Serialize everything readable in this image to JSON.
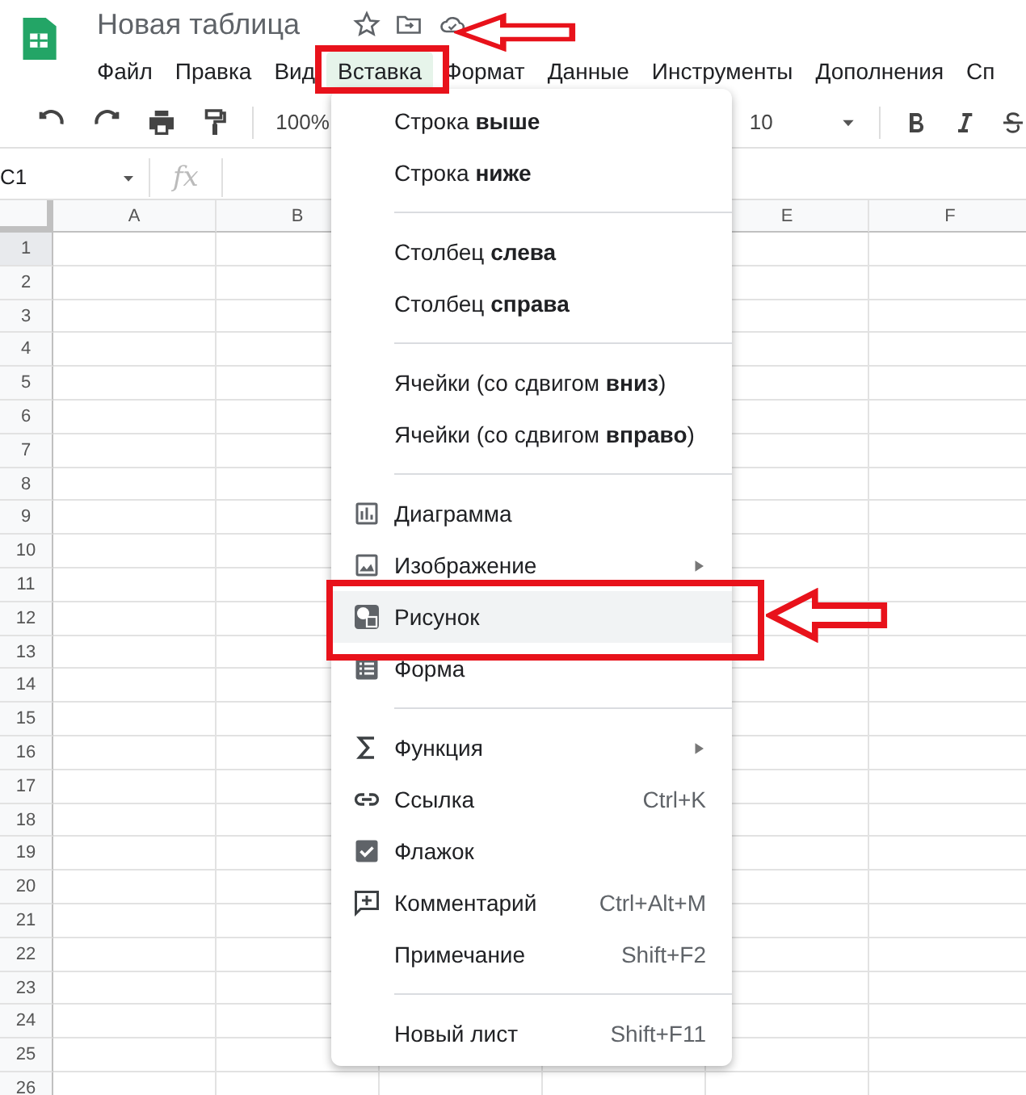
{
  "document": {
    "title": "Новая таблица"
  },
  "menu_bar": [
    {
      "label": "Файл",
      "selected": false
    },
    {
      "label": "Правка",
      "selected": false
    },
    {
      "label": "Вид",
      "selected": false
    },
    {
      "label": "Вставка",
      "selected": true
    },
    {
      "label": "Формат",
      "selected": false
    },
    {
      "label": "Данные",
      "selected": false
    },
    {
      "label": "Инструменты",
      "selected": false
    },
    {
      "label": "Дополнения",
      "selected": false
    },
    {
      "label": "Сп",
      "selected": false
    }
  ],
  "toolbar": {
    "zoom": "100%",
    "font_size": "10"
  },
  "formula_bar": {
    "name_box": "C1",
    "function_label": "fx"
  },
  "columns": [
    "A",
    "B",
    null,
    null,
    "E",
    "F"
  ],
  "rows": [
    {
      "label": "1",
      "selected": true
    },
    {
      "label": "2",
      "selected": false
    },
    {
      "label": "3",
      "selected": false
    },
    {
      "label": "4",
      "selected": false
    },
    {
      "label": "5",
      "selected": false
    },
    {
      "label": "6",
      "selected": false
    },
    {
      "label": "7",
      "selected": false
    },
    {
      "label": "8",
      "selected": false
    },
    {
      "label": "9",
      "selected": false
    },
    {
      "label": "10",
      "selected": false
    },
    {
      "label": "11",
      "selected": false
    },
    {
      "label": "12",
      "selected": false
    },
    {
      "label": "13",
      "selected": false
    },
    {
      "label": "14",
      "selected": false
    },
    {
      "label": "15",
      "selected": false
    },
    {
      "label": "16",
      "selected": false
    },
    {
      "label": "17",
      "selected": false
    },
    {
      "label": "18",
      "selected": false
    },
    {
      "label": "19",
      "selected": false
    },
    {
      "label": "20",
      "selected": false
    },
    {
      "label": "21",
      "selected": false
    },
    {
      "label": "22",
      "selected": false
    },
    {
      "label": "23",
      "selected": false
    },
    {
      "label": "24",
      "selected": false
    },
    {
      "label": "25",
      "selected": false
    },
    {
      "label": "26",
      "selected": false
    }
  ],
  "insert_menu": [
    {
      "kind": "item",
      "label": "Строка **выше**",
      "selected": false
    },
    {
      "kind": "item",
      "label": "Строка **ниже**",
      "selected": false
    },
    {
      "kind": "separator"
    },
    {
      "kind": "item",
      "label": "Столбец **слева**",
      "selected": false
    },
    {
      "kind": "item",
      "label": "Столбец **справа**",
      "selected": false
    },
    {
      "kind": "separator"
    },
    {
      "kind": "item",
      "label": "Ячейки (со сдвигом **вниз**)",
      "selected": false
    },
    {
      "kind": "item",
      "label": "Ячейки (со сдвигом **вправо**)",
      "selected": false
    },
    {
      "kind": "separator"
    },
    {
      "kind": "item",
      "label": "Диаграмма",
      "selected": false
    },
    {
      "kind": "item",
      "label": "Изображение",
      "selected": false,
      "submenu": true
    },
    {
      "kind": "item",
      "label": "Рисунок",
      "selected": true
    },
    {
      "kind": "item",
      "label": "Форма",
      "selected": false
    },
    {
      "kind": "separator"
    },
    {
      "kind": "item",
      "label": "Функция",
      "selected": false,
      "submenu": true
    },
    {
      "kind": "item",
      "label": "Ссылка",
      "selected": false,
      "shortcut": "Ctrl+K"
    },
    {
      "kind": "item",
      "label": "Флажок",
      "selected": false
    },
    {
      "kind": "item",
      "label": "Комментарий",
      "selected": false,
      "shortcut": "Ctrl+Alt+M"
    },
    {
      "kind": "item",
      "label": "Примечание",
      "selected": false,
      "shortcut": "Shift+F2"
    },
    {
      "kind": "separator"
    },
    {
      "kind": "item",
      "label": "Новый лист",
      "selected": false,
      "shortcut": "Shift+F11"
    }
  ]
}
